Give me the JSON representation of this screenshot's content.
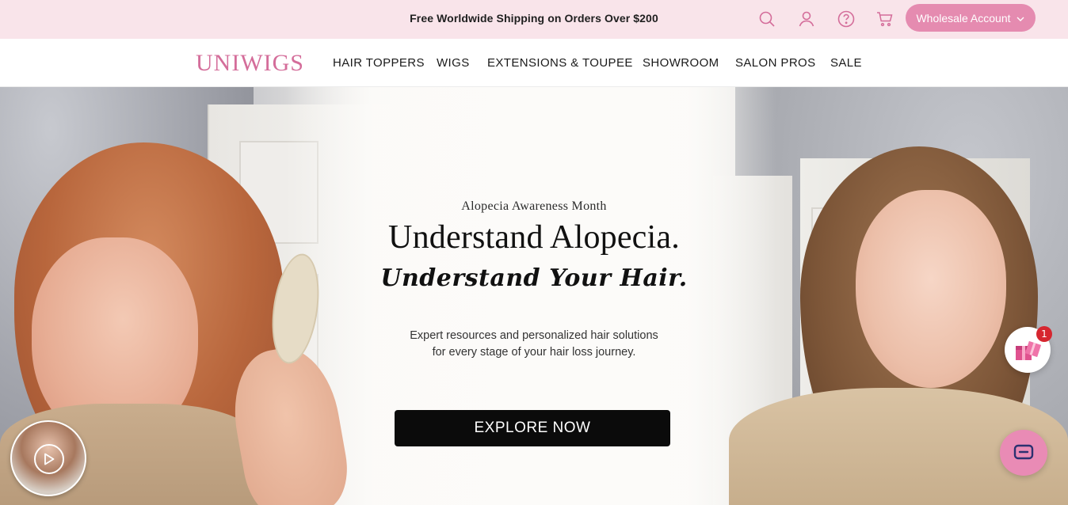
{
  "announcement": {
    "text": "Free Worldwide Shipping on Orders Over $200"
  },
  "header_icons": [
    "search-icon",
    "account-icon",
    "help-icon",
    "cart-icon"
  ],
  "wholesale": {
    "label": "Wholesale Account"
  },
  "brand": {
    "logo": "UNIWIGS",
    "accent_color": "#d46d9a",
    "button_color": "#e58bb0",
    "topbar_color": "#f9e4ea"
  },
  "nav": {
    "items": [
      {
        "label": "HAIR TOPPERS"
      },
      {
        "label": "WIGS"
      },
      {
        "label": "EXTENSIONS & TOUPEE"
      },
      {
        "label": "SHOWROOM"
      },
      {
        "label": "SALON PROS"
      },
      {
        "label": "SALE"
      }
    ]
  },
  "hero": {
    "eyebrow": "Alopecia Awareness Month",
    "headline": "Understand Alopecia.",
    "script": "Understand Your Hair.",
    "desc_line1": "Expert resources and personalized hair solutions",
    "desc_line2": "for every stage of your hair loss journey.",
    "cta": "EXPLORE NOW"
  },
  "widgets": {
    "gift_badge": "1",
    "video_icon": "play-icon",
    "chat_icon": "chat-icon",
    "gift_icon": "gift-icon"
  }
}
